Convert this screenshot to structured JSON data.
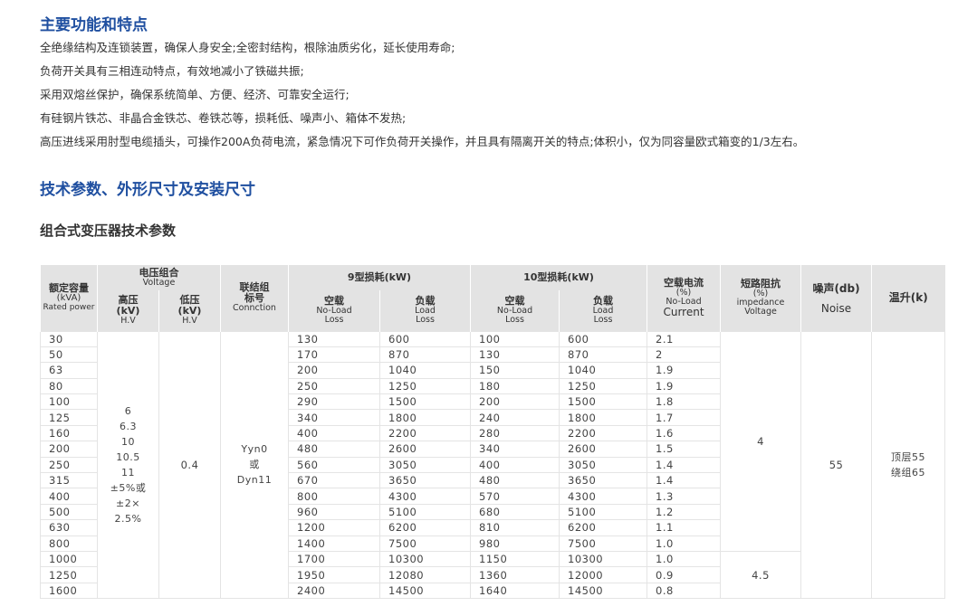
{
  "sections": {
    "features_title": "主要功能和特点",
    "features": [
      "全绝缘结构及连锁装置，确保人身安全;全密封结构，根除油质劣化，延长使用寿命;",
      "负荷开关具有三相连动特点，有效地减小了铁磁共振;",
      "采用双熔丝保护，确保系统简单、方便、经济、可靠安全运行;",
      "有硅钢片铁芯、非晶合金铁芯、卷铁芯等，损耗低、噪声小、箱体不发热;",
      "高压进线采用肘型电缆插头，可操作200A负荷电流，紧急情况下可作负荷开关操作，并且具有隔离开关的特点;体积小，仅为同容量欧式箱变的1/3左右。"
    ],
    "params_title": "技术参数、外形尺寸及安装尺寸",
    "table_title": "组合式变压器技术参数"
  },
  "table": {
    "headers": {
      "capacity": [
        "额定容量",
        "(kVA)",
        "Rated power"
      ],
      "voltage_group": [
        "电压组合",
        "Voltage"
      ],
      "hv": [
        "高压",
        "(kV)",
        "H.V"
      ],
      "lv": [
        "低压",
        "(kV)",
        "H.V"
      ],
      "connection": [
        "联结组",
        "标号",
        "Connction"
      ],
      "loss9": "9型损耗(kW)",
      "loss10": "10型损耗(kW)",
      "noload": [
        "空载",
        "No-Load",
        "Loss"
      ],
      "load": [
        "负载",
        "Load",
        "Loss"
      ],
      "noload_current": [
        "空载电流",
        "(%)",
        "No-Load",
        "Current"
      ],
      "impedance": [
        "短路阻抗",
        "(%)",
        "impedance",
        "Voltage"
      ],
      "noise": [
        "噪声(db)",
        "Noise"
      ],
      "temp_rise": "温升(k)"
    },
    "hv_values": [
      "6",
      "6.3",
      "10",
      "10.5",
      "11",
      "±5%或",
      "±2×",
      "2.5%"
    ],
    "lv_value": "0.4",
    "connection_values": [
      "Yyn0",
      "或",
      "Dyn11"
    ],
    "impedance_values": [
      "4",
      "4.5"
    ],
    "noise_value": "55",
    "temp_rise_values": [
      "顶层55",
      "绕组65"
    ],
    "rows": [
      [
        "30",
        "130",
        "600",
        "100",
        "600",
        "2.1"
      ],
      [
        "50",
        "170",
        "870",
        "130",
        "870",
        "2"
      ],
      [
        "63",
        "200",
        "1040",
        "150",
        "1040",
        "1.9"
      ],
      [
        "80",
        "250",
        "1250",
        "180",
        "1250",
        "1.9"
      ],
      [
        "100",
        "290",
        "1500",
        "200",
        "1500",
        "1.8"
      ],
      [
        "125",
        "340",
        "1800",
        "240",
        "1800",
        "1.7"
      ],
      [
        "160",
        "400",
        "2200",
        "280",
        "2200",
        "1.6"
      ],
      [
        "200",
        "480",
        "2600",
        "340",
        "2600",
        "1.5"
      ],
      [
        "250",
        "560",
        "3050",
        "400",
        "3050",
        "1.4"
      ],
      [
        "315",
        "670",
        "3650",
        "480",
        "3650",
        "1.4"
      ],
      [
        "400",
        "800",
        "4300",
        "570",
        "4300",
        "1.3"
      ],
      [
        "500",
        "960",
        "5100",
        "680",
        "5100",
        "1.2"
      ],
      [
        "630",
        "1200",
        "6200",
        "810",
        "6200",
        "1.1"
      ],
      [
        "800",
        "1400",
        "7500",
        "980",
        "7500",
        "1.0"
      ],
      [
        "1000",
        "1700",
        "10300",
        "1150",
        "10300",
        "1.0"
      ],
      [
        "1250",
        "1950",
        "12080",
        "1360",
        "12000",
        "0.9"
      ],
      [
        "1600",
        "2400",
        "14500",
        "1640",
        "14500",
        "0.8"
      ]
    ]
  }
}
